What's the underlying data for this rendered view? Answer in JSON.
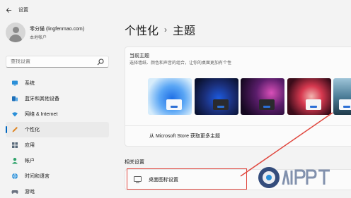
{
  "window": {
    "title": "设置",
    "back_icon": "back-arrow-icon"
  },
  "profile": {
    "name": "零分猫 (lingfenmao.com)",
    "account_type": "本地帐户"
  },
  "search": {
    "placeholder": "查找设置",
    "icon": "search-icon"
  },
  "sidebar": {
    "items": [
      {
        "label": "系统",
        "icon": "monitor-icon",
        "active": false
      },
      {
        "label": "蓝牙和其他设备",
        "icon": "bluetooth-icon",
        "active": false
      },
      {
        "label": "网络 & Internet",
        "icon": "wifi-icon",
        "active": false
      },
      {
        "label": "个性化",
        "icon": "pen-icon",
        "active": true
      },
      {
        "label": "应用",
        "icon": "apps-icon",
        "active": false
      },
      {
        "label": "帐户",
        "icon": "person-icon",
        "active": false
      },
      {
        "label": "时间和语言",
        "icon": "globe-icon",
        "active": false
      },
      {
        "label": "游戏",
        "icon": "gamepad-icon",
        "active": false
      }
    ]
  },
  "breadcrumb": {
    "parent": "个性化",
    "separator": "›",
    "current": "主题"
  },
  "current_theme": {
    "title": "当前主题",
    "description": "选择墙纸、颜色和声音的组合，让你的桌面更加有个性",
    "store_link": "从 Microsoft Store 获取更多主题"
  },
  "related": {
    "title": "相关设置",
    "desktop_icons": "桌面图标设置"
  },
  "colors": {
    "accent": "#0067c0",
    "highlight": "#e0463d"
  }
}
